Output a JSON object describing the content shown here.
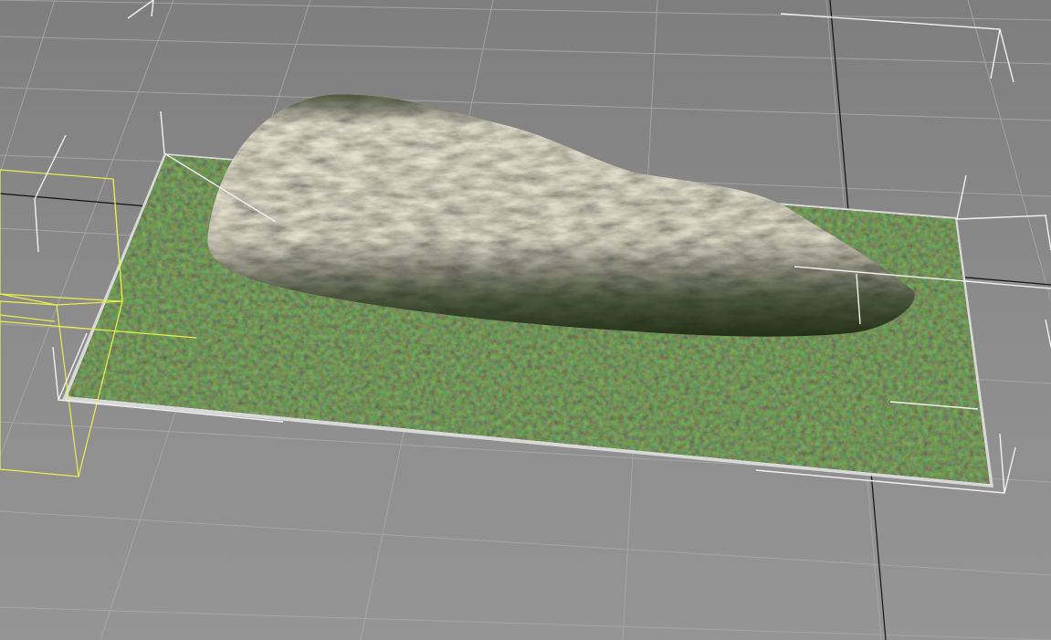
{
  "viewport": {
    "view": "perspective",
    "background_color": "#8b8b8b",
    "grid_line_color": "#a9a9a9",
    "world_axis_color": "#111111",
    "selection_bracket_color": "#f2f2f2",
    "wireframe_box_color": "#e8f04a"
  },
  "scene": {
    "objects": [
      {
        "name": "ground-plane",
        "material": "mossy-grass-texture",
        "selected": true
      },
      {
        "name": "rock-mound",
        "material": "rock-moss-texture",
        "selected": true
      },
      {
        "name": "wireframe-box",
        "display": "wireframe",
        "selected": false
      }
    ]
  }
}
